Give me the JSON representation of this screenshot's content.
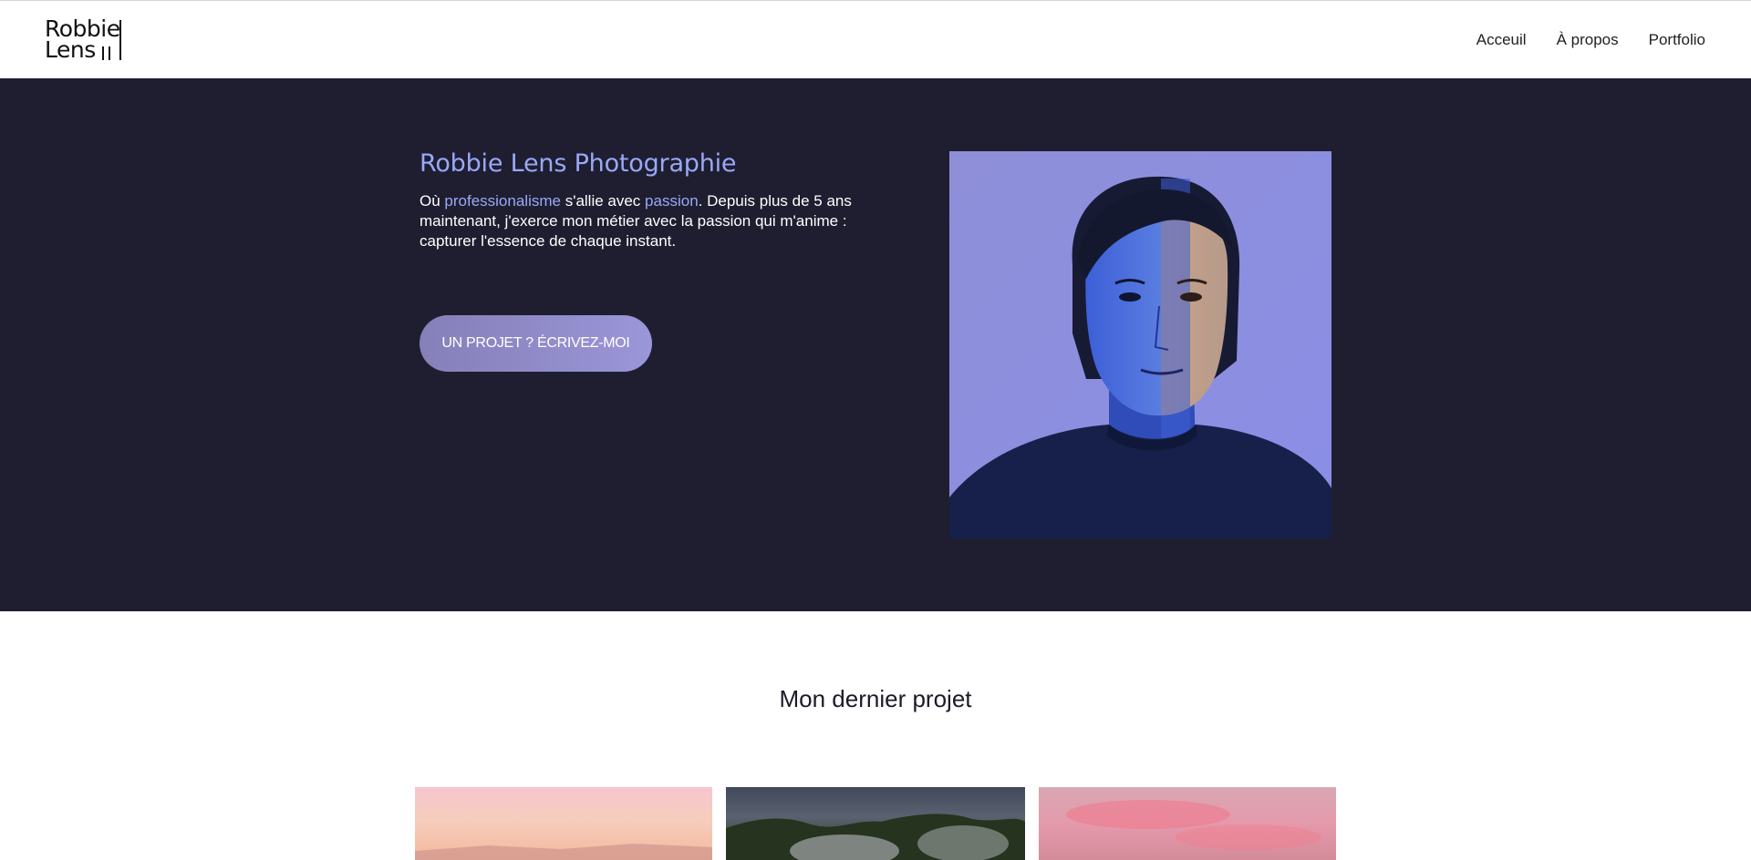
{
  "header": {
    "logo_line1": "Robbie",
    "logo_line2": "Lens",
    "nav": [
      {
        "label": "Acceuil"
      },
      {
        "label": "À propos"
      },
      {
        "label": "Portfolio"
      }
    ]
  },
  "hero": {
    "title": "Robbie Lens Photographie",
    "text_before": "Où ",
    "highlight1": "professionalisme",
    "text_middle": " s'allie avec ",
    "highlight2": "passion",
    "text_after": ". Depuis plus de 5 ans maintenant, j'exerce mon métier avec la passion qui m'anime : capturer l'essence de chaque instant.",
    "cta_label": "UN PROJET ? ÉCRIVEZ-MOI",
    "accent_color": "#9aa8f7",
    "background_color": "#1e1e30"
  },
  "project": {
    "title": "Mon dernier projet"
  }
}
